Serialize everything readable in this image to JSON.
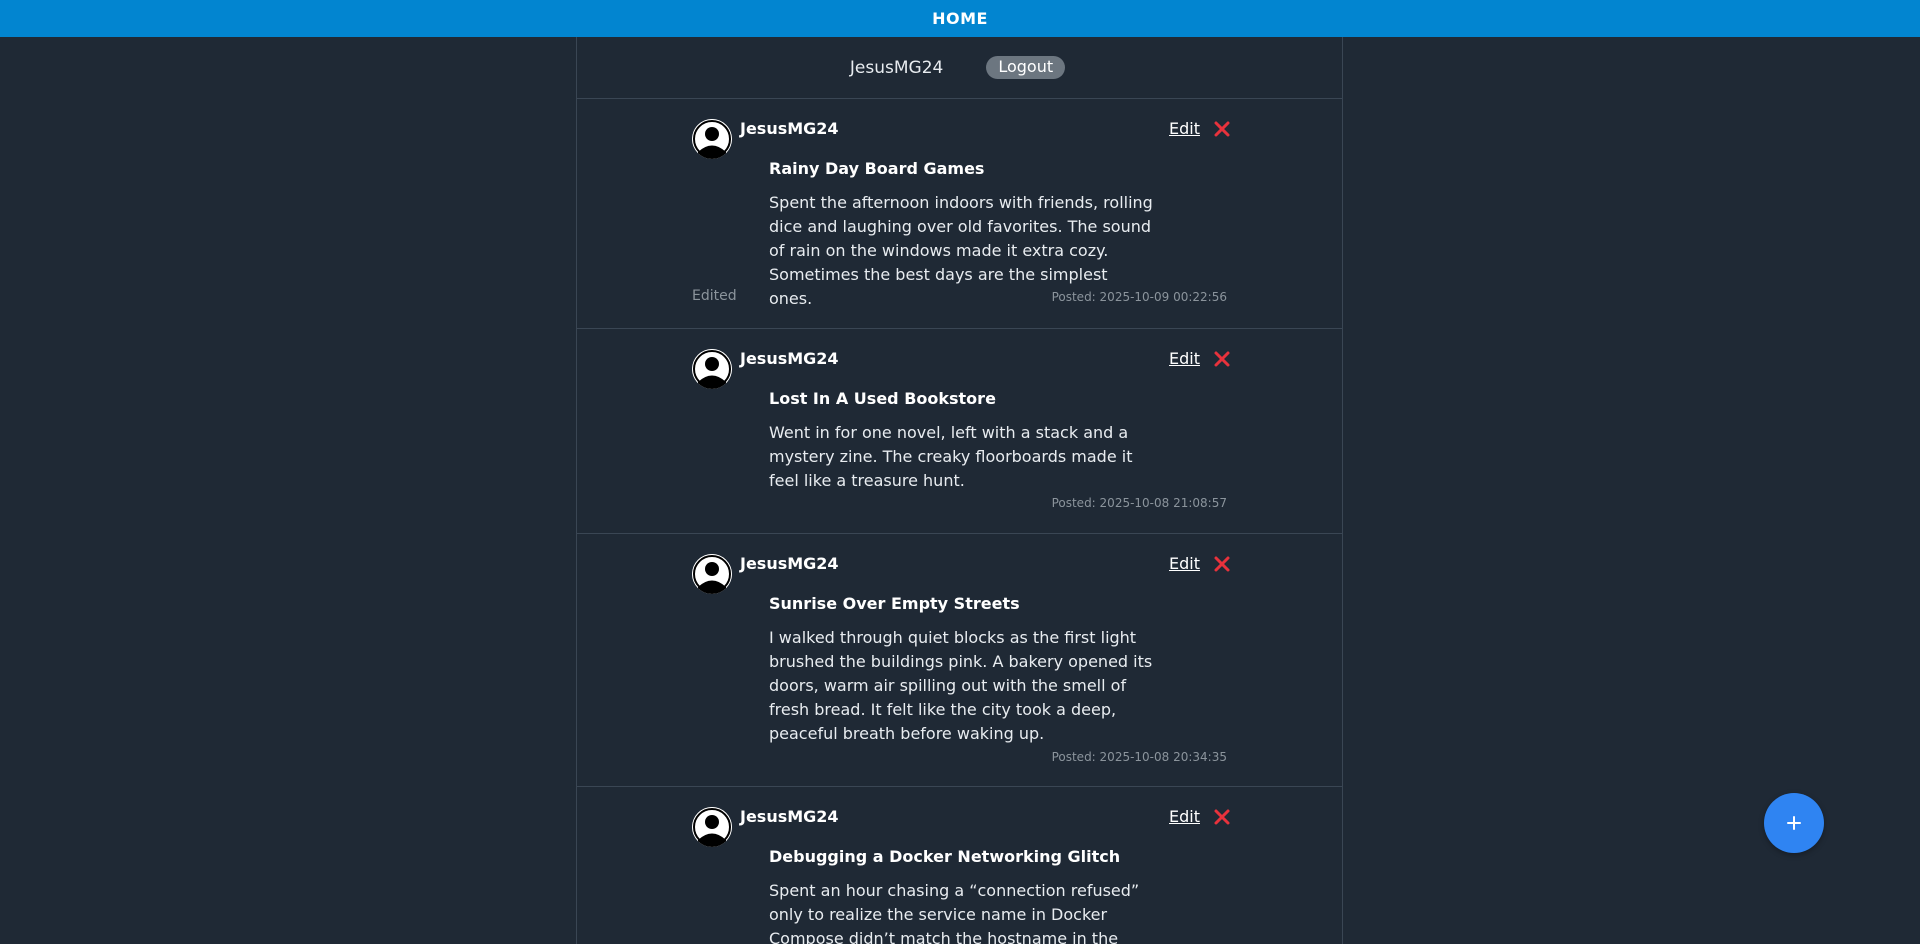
{
  "nav": {
    "home_label": "HOME"
  },
  "userbar": {
    "username": "JesusMG24",
    "logout_label": "Logout"
  },
  "posts": [
    {
      "author": "JesusMG24",
      "edit_label": "Edit",
      "title": "Rainy Day Board Games",
      "body": "Spent the afternoon indoors with friends, rolling dice and laughing over old favorites. The sound of rain on the windows made it extra cozy. Sometimes the best days are the simplest ones.",
      "edited_label": "Edited",
      "posted": "Posted: 2025-10-09 00:22:56"
    },
    {
      "author": "JesusMG24",
      "edit_label": "Edit",
      "title": "Lost In A Used Bookstore",
      "body": "Went in for one novel, left with a stack and a mystery zine. The creaky floorboards made it feel like a treasure hunt.",
      "posted": "Posted: 2025-10-08 21:08:57"
    },
    {
      "author": "JesusMG24",
      "edit_label": "Edit",
      "title": "Sunrise Over Empty Streets",
      "body": "I walked through quiet blocks as the first light brushed the buildings pink. A bakery opened its doors, warm air spilling out with the smell of fresh bread. It felt like the city took a deep, peaceful breath before waking up.",
      "posted": "Posted: 2025-10-08 20:34:35"
    },
    {
      "author": "JesusMG24",
      "edit_label": "Edit",
      "title": "Debugging a Docker Networking Glitch",
      "body": "Spent an hour chasing a “connection refused” only to realize the service name in Docker Compose didn’t match the hostname in the app. Swapped"
    }
  ],
  "icons": {
    "delete": "close-icon",
    "avatar": "user-avatar-icon",
    "new_post": "plus-icon"
  },
  "colors": {
    "nav_bg": "#0285d0",
    "page_bg": "#1f2935",
    "delete_red": "#e8323c",
    "fab_blue": "#2f84f2",
    "logout_bg": "#6c7680"
  }
}
